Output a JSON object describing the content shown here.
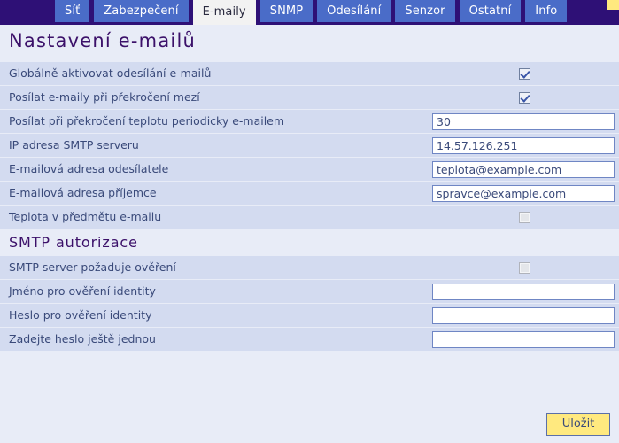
{
  "tabs": [
    {
      "label": "Síť",
      "active": false
    },
    {
      "label": "Zabezpečení",
      "active": false
    },
    {
      "label": "E-maily",
      "active": true
    },
    {
      "label": "SNMP",
      "active": false
    },
    {
      "label": "Odesílání",
      "active": false
    },
    {
      "label": "Senzor",
      "active": false
    },
    {
      "label": "Ostatní",
      "active": false
    },
    {
      "label": "Info",
      "active": false
    }
  ],
  "page": {
    "title": "Nastavení e-mailů"
  },
  "rows": [
    {
      "label": "Globálně aktivovat odesílání e-mailů",
      "type": "checkbox",
      "checked": true,
      "disabled": false
    },
    {
      "label": "Posílat e-maily při překročení mezí",
      "type": "checkbox",
      "checked": true,
      "disabled": false
    },
    {
      "label": "Posílat při překročení teplotu periodicky e-mailem",
      "type": "text",
      "value": "30",
      "placeholder": ""
    },
    {
      "label": "IP adresa SMTP serveru",
      "type": "text",
      "value": "14.57.126.251",
      "placeholder": ""
    },
    {
      "label": "E-mailová adresa odesílatele",
      "type": "text",
      "value": "teplota@example.com",
      "placeholder": ""
    },
    {
      "label": "E-mailová adresa příjemce",
      "type": "text",
      "value": "spravce@example.com",
      "placeholder": ""
    },
    {
      "label": "Teplota v předmětu e-mailu",
      "type": "checkbox",
      "checked": false,
      "disabled": true
    }
  ],
  "section_smtp": {
    "title": "SMTP autorizace",
    "rows": [
      {
        "label": "SMTP server požaduje ověření",
        "type": "checkbox",
        "checked": false,
        "disabled": true
      },
      {
        "label": "Jméno pro ověření identity",
        "type": "text",
        "value": "",
        "placeholder": ""
      },
      {
        "label": "Heslo pro ověření identity",
        "type": "text",
        "value": "",
        "placeholder": ""
      },
      {
        "label": "Zadejte heslo ještě jednou",
        "type": "text",
        "value": "",
        "placeholder": ""
      }
    ]
  },
  "footer": {
    "save_label": "Uložit"
  },
  "colors": {
    "tabbar_bg": "#2e1076",
    "tab_bg": "#4a6cc8",
    "tab_active_bg": "#f2f2f2",
    "page_bg": "#e8ecf7",
    "row_bg": "#d3dbf0",
    "heading": "#3b1069",
    "label_text": "#3a4a7a",
    "input_border": "#6f86c4",
    "save_bg": "#ffe97f",
    "corner_mark": "#ffe97f"
  }
}
